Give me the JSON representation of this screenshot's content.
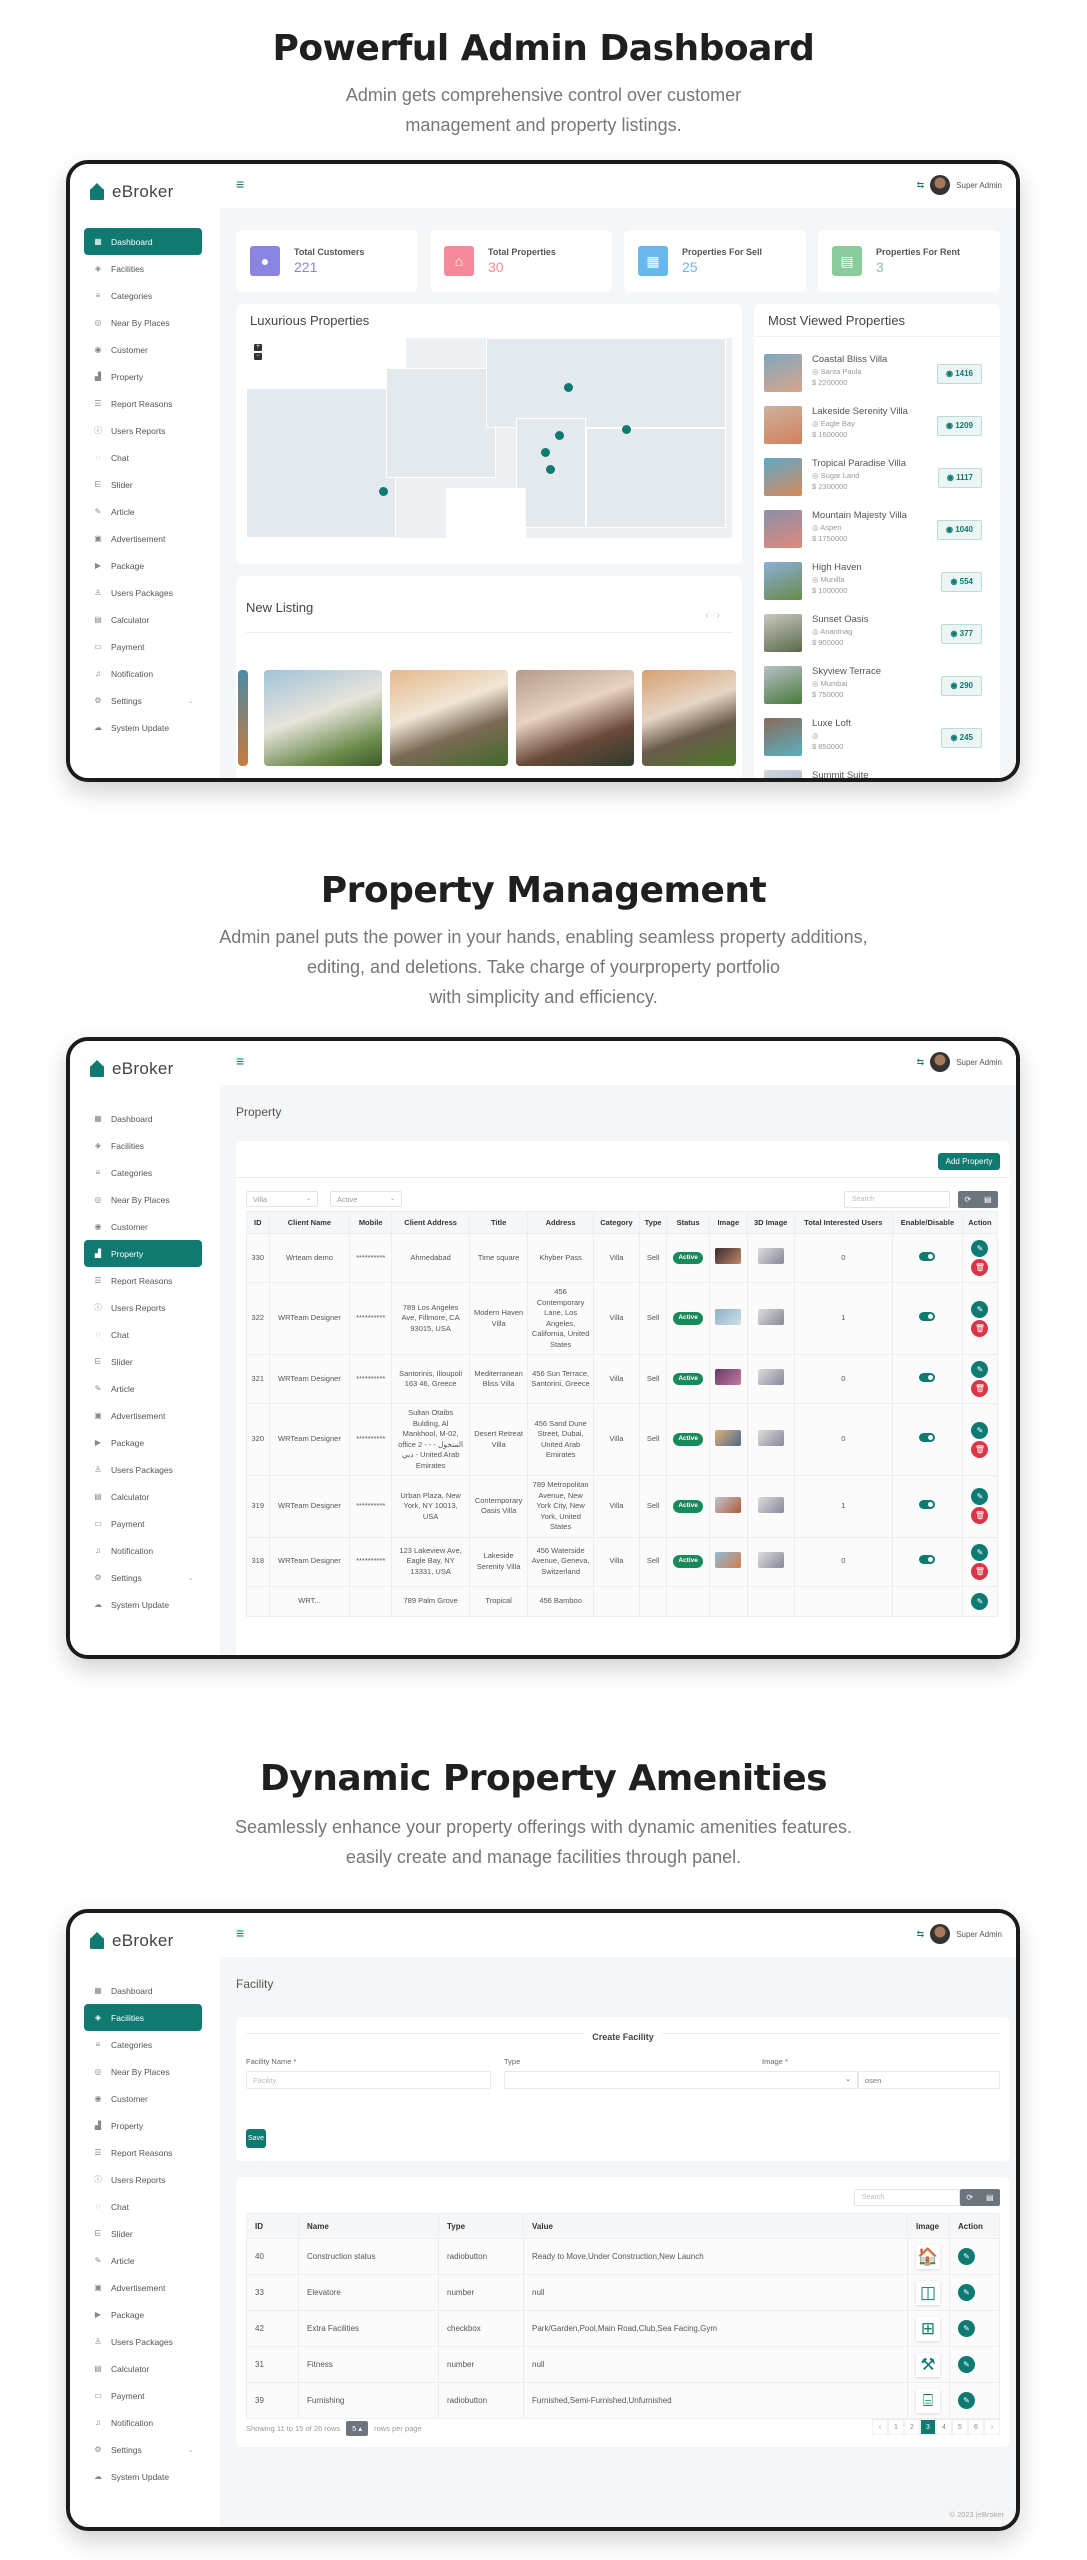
{
  "sections": [
    {
      "title": "Powerful Admin Dashboard",
      "subtitle_lines": [
        "Admin gets comprehensive control over customer",
        "management and property listings."
      ]
    },
    {
      "title": "Property Management",
      "subtitle_lines": [
        "Admin panel puts the power in your hands, enabling seamless property additions,",
        "editing, and deletions. Take charge of yourproperty portfolio",
        "with simplicity and efficiency."
      ]
    },
    {
      "title": "Dynamic Property Amenities",
      "subtitle_lines": [
        "Seamlessly enhance your property offerings with dynamic amenities features.",
        "easily create and manage facilities through panel."
      ]
    }
  ],
  "app": {
    "brand": "eBroker",
    "brand_color": "#0e7a71",
    "user_name": "Super Admin",
    "footer": "© 2023 |eBroker"
  },
  "sidebar": {
    "items": [
      {
        "label": "Dashboard",
        "icon": "grid-icon",
        "glyph": "▦"
      },
      {
        "label": "Facilities",
        "icon": "diamond-icon",
        "glyph": "◈"
      },
      {
        "label": "Categories",
        "icon": "list-icon",
        "glyph": "≡"
      },
      {
        "label": "Near By Places",
        "icon": "location-pin-icon",
        "glyph": "◎"
      },
      {
        "label": "Customer",
        "icon": "user-circle-icon",
        "glyph": "◉"
      },
      {
        "label": "Property",
        "icon": "building-icon",
        "glyph": "▟"
      },
      {
        "label": "Report Reasons",
        "icon": "list-bullets-icon",
        "glyph": "☰"
      },
      {
        "label": "Users Reports",
        "icon": "alert-circle-icon",
        "glyph": "ⓘ"
      },
      {
        "label": "Chat",
        "icon": "chat-bubble-icon",
        "glyph": "◌"
      },
      {
        "label": "Slider",
        "icon": "sliders-icon",
        "glyph": "⋿"
      },
      {
        "label": "Article",
        "icon": "pen-icon",
        "glyph": "✎"
      },
      {
        "label": "Advertisement",
        "icon": "ad-icon",
        "glyph": "▣"
      },
      {
        "label": "Package",
        "icon": "package-icon",
        "glyph": "▶"
      },
      {
        "label": "Users Packages",
        "icon": "users-icon",
        "glyph": "♙"
      },
      {
        "label": "Calculator",
        "icon": "calculator-icon",
        "glyph": "▤"
      },
      {
        "label": "Payment",
        "icon": "payment-icon",
        "glyph": "▭"
      },
      {
        "label": "Notification",
        "icon": "bell-icon",
        "glyph": "♫"
      },
      {
        "label": "Settings",
        "icon": "gear-icon",
        "glyph": "⚙"
      },
      {
        "label": "System Update",
        "icon": "cloud-icon",
        "glyph": "☁"
      }
    ]
  },
  "dashboard": {
    "stats": [
      {
        "label": "Total Customers",
        "value": "221",
        "color": "#8a84e2",
        "glyph": "👤"
      },
      {
        "label": "Total Properties",
        "value": "30",
        "color": "#f4899a",
        "glyph": "⌂"
      },
      {
        "label": "Properties For Sell",
        "value": "25",
        "color": "#68b8ef",
        "glyph": "▦"
      },
      {
        "label": "Properties For Rent",
        "value": "3",
        "color": "#88cc9a",
        "glyph": "▤"
      }
    ],
    "map_title": "Luxurious Properties",
    "map_zoom_in": "+",
    "map_zoom_out": "−",
    "most_viewed_title": "Most Viewed Properties",
    "most_viewed": [
      {
        "name": "Coastal Bliss Villa",
        "location": "Santa Paula",
        "price": "$ 2200000",
        "views": "1416"
      },
      {
        "name": "Lakeside Serenity Villa",
        "location": "Eagle Bay",
        "price": "$ 1600000",
        "views": "1209"
      },
      {
        "name": "Tropical Paradise Villa",
        "location": "Sugar Land",
        "price": "$ 2300000",
        "views": "1117"
      },
      {
        "name": "Mountain Majesty Villa",
        "location": "Aspen",
        "price": "$ 1750000",
        "views": "1040"
      },
      {
        "name": "High Haven",
        "location": "Munilla",
        "price": "$ 1000000",
        "views": "554"
      },
      {
        "name": "Sunset Oasis",
        "location": "Anantnag",
        "price": "$ 900000",
        "views": "377"
      },
      {
        "name": "Skyview Terrace",
        "location": "Mumbai",
        "price": "$ 750000",
        "views": "290"
      },
      {
        "name": "Luxe Loft",
        "location": "",
        "price": "$ 850000",
        "views": "245"
      },
      {
        "name": "Summit Suite",
        "location": "",
        "price": "",
        "views": ""
      }
    ],
    "new_listing_title": "New Listing",
    "prev": "‹",
    "next": "›"
  },
  "property_page": {
    "title": "Property",
    "add_button": "Add Property",
    "filter_category": "Villa",
    "filter_status": "Active",
    "search_placeholder": "Search",
    "columns": [
      "ID",
      "Client Name",
      "Mobile",
      "Client Address",
      "Title",
      "Address",
      "Category",
      "Type",
      "Status",
      "Image",
      "3D Image",
      "Total Interested Users",
      "Enable/Disable",
      "Action"
    ],
    "rows": [
      {
        "id": "330",
        "client": "Wrteam demo",
        "mobile": "**********",
        "client_address": "Ahmedabad",
        "title": "Time square",
        "address": "Khyber Pass",
        "category": "Villa",
        "type": "Sell",
        "status": "Active",
        "interested": "0"
      },
      {
        "id": "322",
        "client": "WRTeam Designer",
        "mobile": "**********",
        "client_address": "789 Los Angeles Ave, Fillmore, CA 93015, USA",
        "title": "Modern Haven Villa",
        "address": "456 Contemporary Lane, Los Angeles, California, United States",
        "category": "Villa",
        "type": "Sell",
        "status": "Active",
        "interested": "1"
      },
      {
        "id": "321",
        "client": "WRTeam Designer",
        "mobile": "**********",
        "client_address": "Santorinis, Ilioupoli 163 46, Greece",
        "title": "Mediterranean Bliss Villa",
        "address": "456 Sun Terrace, Santorini, Greece",
        "category": "Villa",
        "type": "Sell",
        "status": "Active",
        "interested": "0"
      },
      {
        "id": "320",
        "client": "WRTeam Designer",
        "mobile": "**********",
        "client_address": "Sultan Otaibs Bulding, Al Mankhool, M-02, office 2 - المنخول - - دبي - United Arab Emirates",
        "title": "Desert Retreat Villa",
        "address": "456 Sand Dune Street, Dubai, United Arab Emirates",
        "category": "Villa",
        "type": "Sell",
        "status": "Active",
        "interested": "0"
      },
      {
        "id": "319",
        "client": "WRTeam Designer",
        "mobile": "**********",
        "client_address": "Urban Plaza, New York, NY 10013, USA",
        "title": "Contemporary Oasis Villa",
        "address": "789 Metropolitan Avenue, New York City, New York, United States",
        "category": "Villa",
        "type": "Sell",
        "status": "Active",
        "interested": "1"
      },
      {
        "id": "318",
        "client": "WRTeam Designer",
        "mobile": "**********",
        "client_address": "123 Lakeview Ave, Eagle Bay, NY 13331, USA",
        "title": "Lakeside Serenity Villa",
        "address": "456 Waterside Avenue, Geneva, Switzerland",
        "category": "Villa",
        "type": "Sell",
        "status": "Active",
        "interested": "0"
      },
      {
        "id": "",
        "client": "WRT...",
        "mobile": "",
        "client_address": "789 Palm Grove",
        "title": "Tropical",
        "address": "456 Bamboo",
        "category": "",
        "type": "",
        "status": "",
        "interested": ""
      }
    ]
  },
  "facility_page": {
    "title": "Facility",
    "form_title": "Create Facility",
    "name_label": "Facility Name",
    "name_placeholder": "Facility",
    "type_label": "Type",
    "type_value": "",
    "image_label": "Image",
    "image_value": "osen",
    "save_button": "Save",
    "search_placeholder": "Search",
    "columns": [
      "ID",
      "Name",
      "Type",
      "Value",
      "Image",
      "Action"
    ],
    "rows": [
      {
        "id": "40",
        "name": "Construction status",
        "type": "radiobutton",
        "value": "Ready to Move,Under Construction,New Launch",
        "icon": "house-brick-icon",
        "glyph": "🏠"
      },
      {
        "id": "33",
        "name": "Elevatore",
        "type": "number",
        "value": "null",
        "icon": "elevator-icon",
        "glyph": "◫"
      },
      {
        "id": "42",
        "name": "Extra Facilities",
        "type": "checkbox",
        "value": "Park/Garden,Pool,Main Road,Club,Sea Facing,Gym",
        "icon": "amenities-grid-icon",
        "glyph": "⊞"
      },
      {
        "id": "31",
        "name": "Fitness",
        "type": "number",
        "value": "null",
        "icon": "dumbbell-icon",
        "glyph": "⚒"
      },
      {
        "id": "39",
        "name": "Furnishing",
        "type": "radiobutton",
        "value": "Furnished,Semi-Furnished,Unfurnished",
        "icon": "furniture-icon",
        "glyph": "⌸"
      }
    ],
    "pagination_info": "Showing 11 to 15 of 26 rows",
    "page_size": "5 ▴",
    "rows_per_page": "rows per page",
    "pages": [
      "‹",
      "1",
      "2",
      "3",
      "4",
      "5",
      "6",
      "›"
    ],
    "current_page": "3"
  }
}
